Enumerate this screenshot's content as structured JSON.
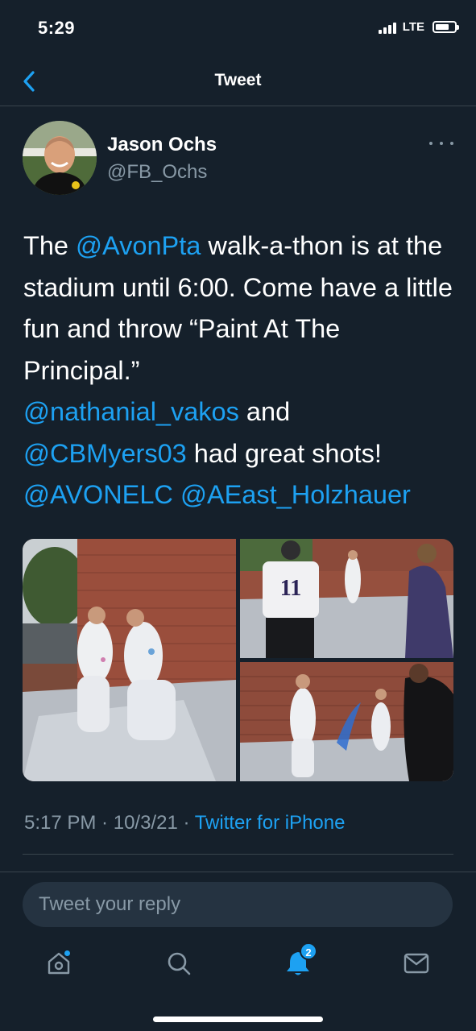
{
  "status_bar": {
    "time": "5:29",
    "network": "LTE"
  },
  "nav": {
    "title": "Tweet"
  },
  "tweet": {
    "author_name": "Jason Ochs",
    "author_handle": "@FB_Ochs",
    "text_segments": [
      {
        "text": "The ",
        "mention": false
      },
      {
        "text": "@AvonPta",
        "mention": true
      },
      {
        "text": " walk-a-thon is at the stadium until 6:00.  Come have a little fun and throw “Paint At The Principal.”",
        "mention": false
      },
      {
        "text": "@nathanial_vakos",
        "mention": true
      },
      {
        "text": "  and ",
        "mention": false
      },
      {
        "text": "@CBMyers03",
        "mention": true
      },
      {
        "text": " had great shots! ",
        "mention": false
      },
      {
        "text": "@AVONELC",
        "mention": true
      },
      {
        "text": " ",
        "mention": false
      },
      {
        "text": "@AEast_Holzhauer",
        "mention": true
      }
    ],
    "time": "5:17 PM",
    "date": "10/3/21",
    "source": "Twitter for iPhone",
    "jersey_number": "11"
  },
  "reply": {
    "placeholder": "Tweet your reply"
  },
  "tabs": {
    "notifications_badge": "2"
  },
  "colors": {
    "background": "#15202b",
    "accent": "#1da1f2",
    "secondary_text": "#8899a6",
    "divider": "#38444d"
  },
  "icons": [
    "back-chevron-icon",
    "more-icon",
    "home-icon",
    "search-icon",
    "bell-icon",
    "mail-icon"
  ]
}
